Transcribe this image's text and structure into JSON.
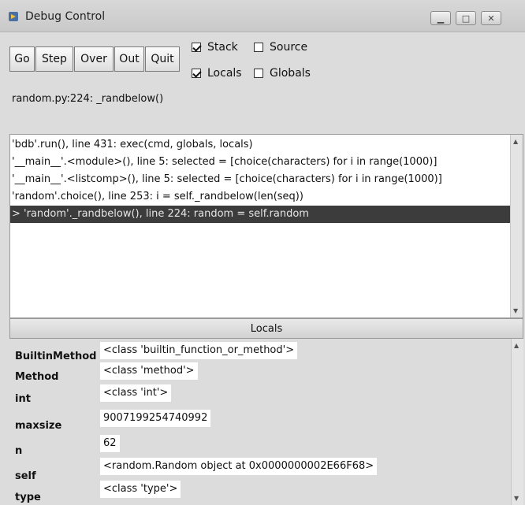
{
  "window": {
    "title": "Debug Control"
  },
  "toolbar": {
    "go": "Go",
    "step": "Step",
    "over": "Over",
    "out": "Out",
    "quit": "Quit"
  },
  "options": {
    "stack": {
      "label": "Stack",
      "checked": true
    },
    "source": {
      "label": "Source",
      "checked": false
    },
    "locals": {
      "label": "Locals",
      "checked": true
    },
    "globals": {
      "label": "Globals",
      "checked": false
    }
  },
  "status": "random.py:224: _randbelow()",
  "stack": {
    "rows": [
      "'bdb'.run(), line 431: exec(cmd, globals, locals)",
      "'__main__'.<module>(), line 5: selected = [choice(characters) for i in range(1000)]",
      "'__main__'.<listcomp>(), line 5: selected = [choice(characters) for i in range(1000)]",
      "'random'.choice(), line 253: i = self._randbelow(len(seq))",
      "> 'random'._randbelow(), line 224: random = self.random"
    ],
    "selected_index": 4
  },
  "locals": {
    "header": "Locals",
    "rows": [
      {
        "name": "BuiltinMethod",
        "value": "<class 'builtin_function_or_method'>"
      },
      {
        "name": "Method",
        "value": "<class 'method'>"
      },
      {
        "name": "int",
        "value": "<class 'int'>"
      },
      {
        "name": "maxsize",
        "value": "9007199254740992"
      },
      {
        "name": "n",
        "value": "62"
      },
      {
        "name": "self",
        "value": "<random.Random object at 0x0000000002E66F68>"
      },
      {
        "name": "type",
        "value": "<class 'type'>"
      }
    ]
  }
}
